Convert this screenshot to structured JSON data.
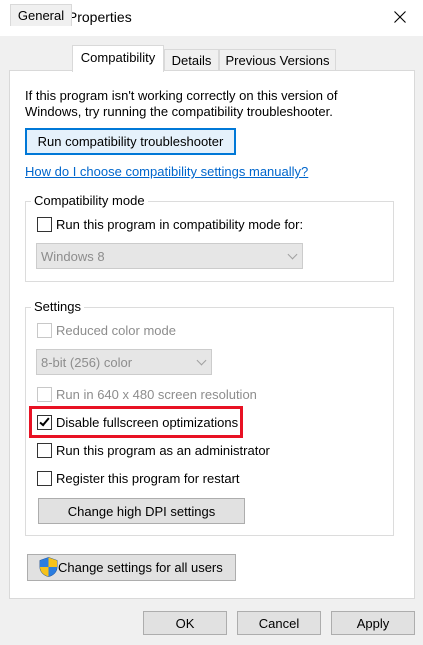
{
  "window": {
    "title": "FSD Properties",
    "close_icon": "close-icon"
  },
  "tabs": [
    {
      "label": "General",
      "active": false
    },
    {
      "label": "Compatibility",
      "active": true
    },
    {
      "label": "Details",
      "active": false
    },
    {
      "label": "Previous Versions",
      "active": false
    }
  ],
  "intro_text": "If this program isn't working correctly on this version of Windows, try running the compatibility troubleshooter.",
  "troubleshooter_button": "Run compatibility troubleshooter",
  "manual_link": "How do I choose compatibility settings manually?",
  "compat_mode": {
    "group_label": "Compatibility mode",
    "checkbox_label": "Run this program in compatibility mode for:",
    "checked": false,
    "os_select_value": "Windows 8"
  },
  "settings": {
    "group_label": "Settings",
    "reduced_color": {
      "label": "Reduced color mode",
      "checked": false,
      "enabled": false
    },
    "color_select_value": "8-bit (256) color",
    "res_640": {
      "label": "Run in 640 x 480 screen resolution",
      "checked": false,
      "enabled": false
    },
    "disable_fullscreen": {
      "label": "Disable fullscreen optimizations",
      "checked": true,
      "enabled": true
    },
    "run_as_admin": {
      "label": "Run this program as an administrator",
      "checked": false,
      "enabled": true
    },
    "register_restart": {
      "label": "Register this program for restart",
      "checked": false,
      "enabled": true
    },
    "dpi_button": "Change high DPI settings"
  },
  "all_users_button": "Change settings for all users",
  "footer": {
    "ok": "OK",
    "cancel": "Cancel",
    "apply": "Apply"
  },
  "colors": {
    "highlight": "#e81123",
    "link": "#0066cc",
    "focus_border": "#0078d7"
  }
}
